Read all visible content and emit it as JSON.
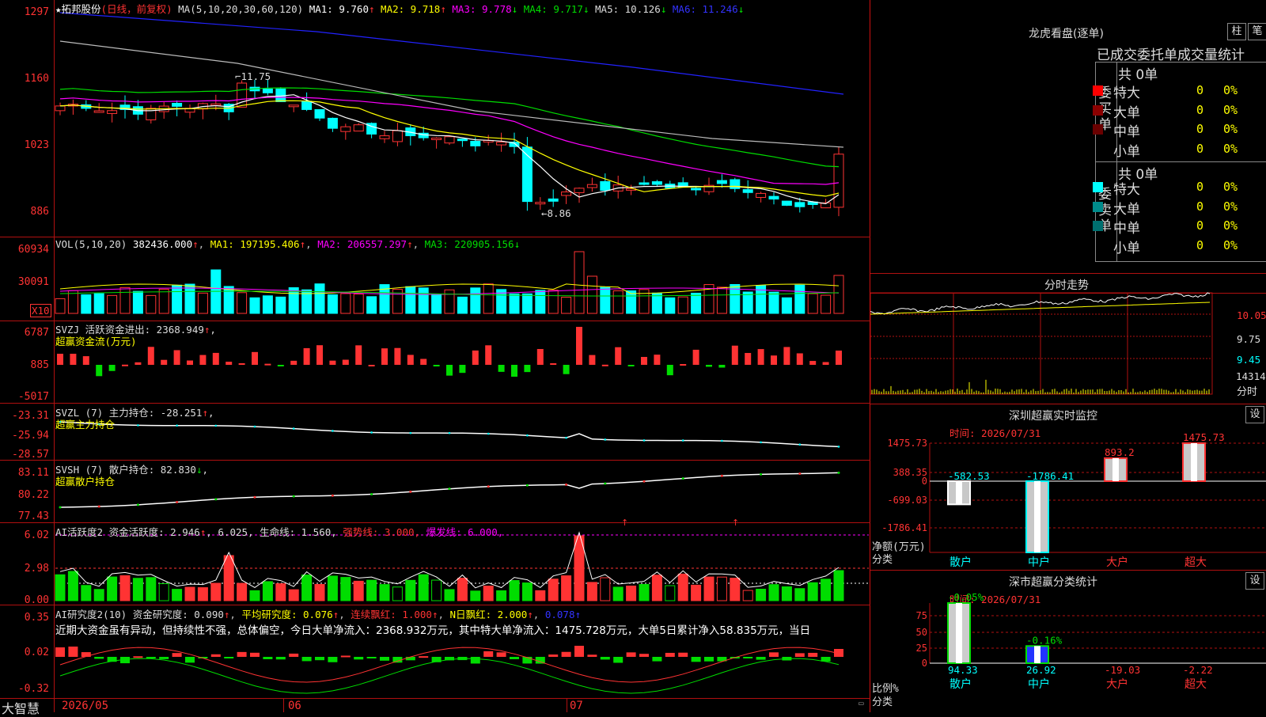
{
  "colors": {
    "up": "#ff3333",
    "down": "#00ffff",
    "green": "#00dd00",
    "yellow": "#ffff00",
    "magenta": "#ff00ff",
    "white": "#ffffff",
    "grid": "#b01010"
  },
  "main": {
    "title_star": "★",
    "stock": "拓邦股份",
    "mode": "(日线，前复权)",
    "ma_def": "MA(5,10,20,30,60,120)",
    "ma1": "MA1: 9.760",
    "ma1_arrow": "↑",
    "ma2": "MA2: 9.718",
    "ma2_arrow": "↑",
    "ma3": "MA3: 9.778",
    "ma3_arrow": "↓",
    "ma4": "MA4: 9.717",
    "ma4_arrow": "↓",
    "ma5": "MA5: 10.126",
    "ma5_arrow": "↓",
    "ma6": "MA6: 11.246",
    "ma6_arrow": "↓",
    "yticks": [
      "1297",
      "1160",
      "1023",
      "886"
    ],
    "hi_label": "11.75",
    "lo_label": "←8.86"
  },
  "vol": {
    "name": "VOL(5,10,20)",
    "val": "382436.000",
    "val_arrow": "↑",
    "ma1": "MA1: 197195.406",
    "ma1_arrow": "↑",
    "ma2": "MA2: 206557.297",
    "ma2_arrow": "↑",
    "ma3": "MA3: 220905.156",
    "ma3_arrow": "↓",
    "yticks": [
      "60934",
      "30091"
    ],
    "unit": "X10"
  },
  "svzj": {
    "name": "SVZJ  活跃资金进出: 2368.949",
    "arrow": "↑",
    "sep": ",",
    "sub": "超赢资金流(万元)",
    "yticks": [
      "6787",
      "885",
      "-5017"
    ]
  },
  "svzl": {
    "name": "SVZL (7) 主力持仓: -28.251",
    "arrow": "↑",
    "sep": ",",
    "sub": "超赢主力持仓",
    "yticks": [
      "-23.31",
      "-25.94",
      "-28.57"
    ]
  },
  "svsh": {
    "name": "SVSH (7) 散户持仓: 82.830",
    "arrow": "↓",
    "sep": ",",
    "sub": "超赢散户持仓",
    "yticks": [
      "83.11",
      "80.22",
      "77.43"
    ]
  },
  "ai1": {
    "name": "AI活跃度2 资金活跃度: 2.946",
    "arrow": "↑",
    "sep": ",",
    "v2": "6.025,",
    "life": "生命线: 1.560,",
    "strong": "强势线: 3.000,",
    "burst": "爆发线: 6.000,",
    "yticks": [
      "6.02",
      "2.98",
      "0.00"
    ]
  },
  "ai2": {
    "name": "AI研究度2(10) 资金研究度: 0.090",
    "arrow1": "↑",
    "avg": "平均研究度: 0.076",
    "arrow2": "↑",
    "cont": "连续飘红: 1.000",
    "arrow3": "↑",
    "n": "N日飘红: 2.000",
    "arrow4": "↑",
    "last": "0.078",
    "arrow5": "↑",
    "text": "近期大资金虽有异动，但持续性不强，总体偏空，今日大单净流入：2368.932万元，其中特大单净流入：1475.728万元，大单5日累计净入58.835万元，当日",
    "yticks": [
      "0.35",
      "0.02",
      "-0.32"
    ]
  },
  "xaxis": {
    "brand": "大智慧",
    "labels": [
      "2026/05",
      "06",
      "07"
    ]
  },
  "lhb": {
    "title": "龙虎看盘(逐单)",
    "btn1": "柱",
    "btn2": "笔",
    "tabs": "已成交委托单成交量统计",
    "buy_label": "委买单",
    "buy_total": "共 0单",
    "sell_label": "委卖单",
    "sell_total": "共 0单",
    "rows": [
      {
        "name": "特大",
        "val": "0",
        "pct": "0%"
      },
      {
        "name": "大单",
        "val": "0",
        "pct": "0%"
      },
      {
        "name": "中单",
        "val": "0",
        "pct": "0%"
      },
      {
        "name": "小单",
        "val": "0",
        "pct": "0%"
      }
    ],
    "buy_colors": [
      "#ff0000",
      "#8b0000",
      "#6a0000",
      ""
    ],
    "sell_colors": [
      "#00ffff",
      "#008b8b",
      "#007070",
      ""
    ]
  },
  "fenshi": {
    "title": "分时走势",
    "yticks": [
      "10.05",
      "9.75",
      "9.45"
    ],
    "vol": "14314",
    "unit": "分时"
  },
  "realtime": {
    "title": "深圳超赢实时监控",
    "btn": "设",
    "time": "时间: 2026/07/31",
    "yticks": [
      "1475.73",
      "388.35",
      "0",
      "-699.03",
      "-1786.41"
    ],
    "ylabel1": "净额(万元)",
    "ylabel2": "分类",
    "bars": [
      {
        "name": "散户",
        "value": -582.53,
        "label": "-582.53"
      },
      {
        "name": "中户",
        "value": -1786.41,
        "label": "-1786.41"
      },
      {
        "name": "大户",
        "value": 893.2,
        "label": "893.2"
      },
      {
        "name": "超大",
        "value": 1475.73,
        "label": "1475.73"
      }
    ]
  },
  "classify": {
    "title": "深市超赢分类统计",
    "btn": "设",
    "time": "时间: 2026/07/31",
    "yticks": [
      "75",
      "50",
      "25",
      "0"
    ],
    "ylabel1": "比例%",
    "ylabel2": "分类",
    "bars": [
      {
        "name": "散户",
        "value": 94.33,
        "label": "94.33",
        "top": "-0.05%"
      },
      {
        "name": "中户",
        "value": 26.92,
        "label": "26.92",
        "top": "-0.16%"
      },
      {
        "name": "大户",
        "value": -19.03,
        "label": "-19.03",
        "top": ""
      },
      {
        "name": "超大",
        "value": -2.22,
        "label": "-2.22",
        "top": ""
      }
    ]
  },
  "chart_data": [
    {
      "type": "candlestick",
      "title": "拓邦股份(日线，前复权)",
      "ylim": [
        886,
        1297
      ],
      "y_unit": "price×100",
      "x_labels": [
        "2026/05",
        "06",
        "07"
      ],
      "annotations": [
        "11.75",
        "8.86"
      ]
    },
    {
      "type": "bar",
      "title": "VOL(5,10,20)",
      "ylim": [
        0,
        60934
      ],
      "series": [
        {
          "name": "VOL",
          "last": 382436.0
        },
        {
          "name": "MA1",
          "last": 197195.406
        },
        {
          "name": "MA2",
          "last": 206557.297
        },
        {
          "name": "MA3",
          "last": 220905.156
        }
      ]
    },
    {
      "type": "bar",
      "title": "SVZJ 活跃资金进出",
      "ylim": [
        -5017,
        6787
      ],
      "last": 2368.949
    },
    {
      "type": "line",
      "title": "SVZL (7) 主力持仓",
      "ylim": [
        -28.57,
        -23.31
      ],
      "last": -28.251
    },
    {
      "type": "line",
      "title": "SVSH (7) 散户持仓",
      "ylim": [
        77.43,
        83.11
      ],
      "last": 82.83
    },
    {
      "type": "bar",
      "title": "AI活跃度2",
      "ylim": [
        0,
        6.02
      ],
      "last": 2.946
    },
    {
      "type": "bar",
      "title": "AI研究度2(10)",
      "ylim": [
        -0.32,
        0.35
      ],
      "last": 0.09
    },
    {
      "type": "bar",
      "title": "深圳超赢实时监控",
      "categories": [
        "散户",
        "中户",
        "大户",
        "超大"
      ],
      "values": [
        -582.53,
        -1786.41,
        893.2,
        1475.73
      ],
      "ylim": [
        -1786.41,
        1475.73
      ]
    },
    {
      "type": "bar",
      "title": "深市超赢分类统计",
      "categories": [
        "散户",
        "中户",
        "大户",
        "超大"
      ],
      "values": [
        94.33,
        26.92,
        -19.03,
        -2.22
      ],
      "ylim": [
        0,
        75
      ]
    }
  ]
}
